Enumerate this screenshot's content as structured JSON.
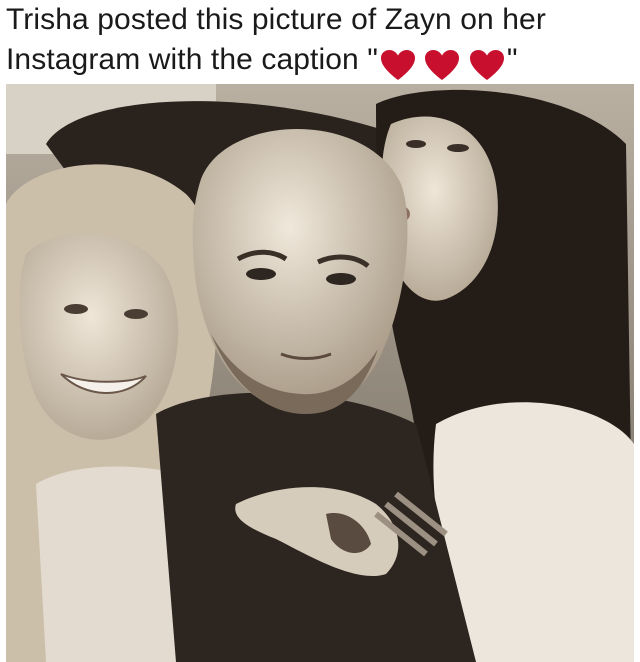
{
  "caption": {
    "line1": "Trisha posted this picture of Zayn on her",
    "line2_prefix": "Instagram with the caption \"",
    "line2_suffix": "\"",
    "emoji": [
      "red-heart",
      "red-heart",
      "red-heart"
    ],
    "heart_color": "#c8102e"
  },
  "photo": {
    "subject": "sepia selfie photograph",
    "tone_colors": [
      "#2a221c",
      "#8a7f72",
      "#e9e2d6"
    ]
  }
}
